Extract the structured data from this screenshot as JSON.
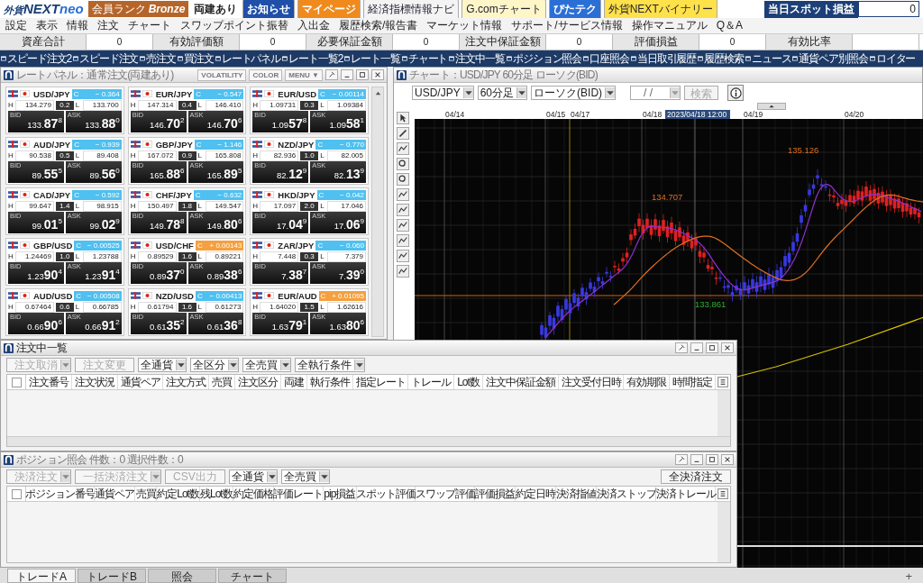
{
  "header": {
    "logo": {
      "prefix": "外貨",
      "main": "NEXT",
      "suffix": "neo"
    },
    "rank": {
      "caption": "会員ランク",
      "name": "Bronze"
    },
    "mode": "両建あり",
    "links": [
      {
        "label": "お知らせ",
        "color": "#1f4fa8"
      },
      {
        "label": "マイページ",
        "color": "#f08a1c"
      },
      {
        "label": "経済指標",
        "sub": "情報ナビ",
        "color": "#f4f4f4"
      },
      {
        "label": "G.com",
        "sub": "チャート",
        "color": "#fff6c8"
      },
      {
        "label": "ぴたテク",
        "color": "#2a6fd6"
      },
      {
        "label": "外貨NEXT",
        "sub": "バイナリー",
        "color": "#ffe14a"
      }
    ],
    "spot_pl": {
      "label": "当日スポット損益",
      "value": "0"
    }
  },
  "menu": [
    "設定",
    "表示",
    "情報",
    "注文",
    "チャート",
    "スワップポイント振替",
    "入出金",
    "履歴検索/報告書",
    "マーケット情報",
    "サポート/サービス情報",
    "操作マニュアル",
    "Q＆A"
  ],
  "summary": [
    {
      "label": "資産合計",
      "value": "0"
    },
    {
      "label": "有効評価額",
      "value": "0"
    },
    {
      "label": "必要保証金額",
      "value": "0"
    },
    {
      "label": "注文中保証金額",
      "value": "0"
    },
    {
      "label": "評価損益",
      "value": "0"
    },
    {
      "label": "有効比率"
    }
  ],
  "toolbar": [
    "スピード注文2",
    "スピード注文",
    "売注文",
    "買注文",
    "レートパネル",
    "レート一覧2",
    "レート一覧",
    "チャート",
    "注文中一覧",
    "ポジション照会",
    "口座照会",
    "当日取引履歴",
    "履歴検索",
    "ニュース",
    "通貨ペア別照会",
    "ロイター"
  ],
  "rate_panel": {
    "title": "レートパネル：通常注文(両建あり)",
    "buttons": [
      "VOLATILITY",
      "COLOR",
      "MENU ▼"
    ],
    "cards": [
      {
        "pair": "USD/JPY",
        "c": "C",
        "change": "− 0.364",
        "rising": false,
        "h": "H",
        "high": "134.279",
        "spread": "0.2",
        "l": "L",
        "low": "133.700",
        "bid": {
          "label": "BID",
          "pre": "133.",
          "big": "87",
          "sup": "8"
        },
        "ask": {
          "label": "ASK",
          "pre": "133.",
          "big": "88",
          "sup": "0"
        }
      },
      {
        "pair": "EUR/JPY",
        "c": "C",
        "change": "− 0.547",
        "rising": false,
        "h": "H",
        "high": "147.314",
        "spread": "0.4",
        "l": "L",
        "low": "146.410",
        "bid": {
          "label": "BID",
          "pre": "146.",
          "big": "70",
          "sup": "2"
        },
        "ask": {
          "label": "ASK",
          "pre": "146.",
          "big": "70",
          "sup": "6"
        }
      },
      {
        "pair": "EUR/USD",
        "c": "C",
        "change": "− 0.00114",
        "rising": false,
        "h": "H",
        "high": "1.09731",
        "spread": "0.3",
        "l": "L",
        "low": "1.09384",
        "bid": {
          "label": "BID",
          "pre": "1.09",
          "big": "57",
          "sup": "8"
        },
        "ask": {
          "label": "ASK",
          "pre": "1.09",
          "big": "58",
          "sup": "1"
        }
      },
      {
        "pair": "AUD/JPY",
        "c": "C",
        "change": "− 0.939",
        "rising": false,
        "h": "H",
        "high": "90.538",
        "spread": "0.5",
        "l": "L",
        "low": "89.408",
        "bid": {
          "label": "BID",
          "pre": "89.",
          "big": "55",
          "sup": "5"
        },
        "ask": {
          "label": "ASK",
          "pre": "89.",
          "big": "56",
          "sup": "0"
        }
      },
      {
        "pair": "GBP/JPY",
        "c": "C",
        "change": "− 1.146",
        "rising": false,
        "h": "H",
        "high": "167.072",
        "spread": "0.9",
        "l": "L",
        "low": "165.808",
        "bid": {
          "label": "BID",
          "pre": "165.",
          "big": "88",
          "sup": "6"
        },
        "ask": {
          "label": "ASK",
          "pre": "165.",
          "big": "89",
          "sup": "5"
        }
      },
      {
        "pair": "NZD/JPY",
        "c": "C",
        "change": "− 0.770",
        "rising": false,
        "h": "H",
        "high": "82.936",
        "spread": "1.0",
        "l": "L",
        "low": "82.005",
        "bid": {
          "label": "BID",
          "pre": "82.",
          "big": "12",
          "sup": "9"
        },
        "ask": {
          "label": "ASK",
          "pre": "82.",
          "big": "13",
          "sup": "9"
        }
      },
      {
        "pair": "CAD/JPY",
        "c": "C",
        "change": "− 0.592",
        "rising": false,
        "h": "H",
        "high": "99.647",
        "spread": "1.4",
        "l": "L",
        "low": "98.915",
        "bid": {
          "label": "BID",
          "pre": "99.",
          "big": "01",
          "sup": "5"
        },
        "ask": {
          "label": "ASK",
          "pre": "99.",
          "big": "02",
          "sup": "9"
        }
      },
      {
        "pair": "CHF/JPY",
        "c": "C",
        "change": "− 0.632",
        "rising": false,
        "h": "H",
        "high": "150.497",
        "spread": "1.8",
        "l": "L",
        "low": "149.547",
        "bid": {
          "label": "BID",
          "pre": "149.",
          "big": "78",
          "sup": "8"
        },
        "ask": {
          "label": "ASK",
          "pre": "149.",
          "big": "80",
          "sup": "6"
        }
      },
      {
        "pair": "HKD/JPY",
        "c": "C",
        "change": "− 0.042",
        "rising": false,
        "h": "H",
        "high": "17.097",
        "spread": "2.0",
        "l": "L",
        "low": "17.046",
        "bid": {
          "label": "BID",
          "pre": "17.",
          "big": "04",
          "sup": "9"
        },
        "ask": {
          "label": "ASK",
          "pre": "17.",
          "big": "06",
          "sup": "9"
        }
      },
      {
        "pair": "GBP/USD",
        "c": "C",
        "change": "− 0.00525",
        "rising": false,
        "h": "H",
        "high": "1.24469",
        "spread": "1.0",
        "l": "L",
        "low": "1.23788",
        "bid": {
          "label": "BID",
          "pre": "1.23",
          "big": "90",
          "sup": "4"
        },
        "ask": {
          "label": "ASK",
          "pre": "1.23",
          "big": "91",
          "sup": "4"
        }
      },
      {
        "pair": "USD/CHF",
        "c": "C",
        "change": "+ 0.00143",
        "rising": true,
        "h": "H",
        "high": "0.89529",
        "spread": "1.6",
        "l": "L",
        "low": "0.89221",
        "bid": {
          "label": "BID",
          "pre": "0.89",
          "big": "37",
          "sup": "0"
        },
        "ask": {
          "label": "ASK",
          "pre": "0.89",
          "big": "38",
          "sup": "6"
        }
      },
      {
        "pair": "ZAR/JPY",
        "c": "C",
        "change": "− 0.060",
        "rising": false,
        "h": "H",
        "high": "7.448",
        "spread": "0.3",
        "l": "L",
        "low": "7.379",
        "bid": {
          "label": "BID",
          "pre": "7.",
          "big": "38",
          "sup": "7"
        },
        "ask": {
          "label": "ASK",
          "pre": "7.",
          "big": "39",
          "sup": "0"
        }
      },
      {
        "pair": "AUD/USD",
        "c": "C",
        "change": "− 0.00508",
        "rising": false,
        "h": "H",
        "high": "0.67464",
        "spread": "0.6",
        "l": "L",
        "low": "0.66785",
        "bid": {
          "label": "BID",
          "pre": "0.66",
          "big": "90",
          "sup": "6"
        },
        "ask": {
          "label": "ASK",
          "pre": "0.66",
          "big": "91",
          "sup": "2"
        }
      },
      {
        "pair": "NZD/USD",
        "c": "C",
        "change": "− 0.00413",
        "rising": false,
        "h": "H",
        "high": "0.61794",
        "spread": "1.6",
        "l": "L",
        "low": "0.61273",
        "bid": {
          "label": "BID",
          "pre": "0.61",
          "big": "35",
          "sup": "2"
        },
        "ask": {
          "label": "ASK",
          "pre": "0.61",
          "big": "36",
          "sup": "8"
        }
      },
      {
        "pair": "EUR/AUD",
        "c": "C",
        "change": "+ 0.01095",
        "rising": true,
        "h": "H",
        "high": "1.64020",
        "spread": "1.5",
        "l": "L",
        "low": "1.62616",
        "bid": {
          "label": "BID",
          "pre": "1.63",
          "big": "79",
          "sup": "1"
        },
        "ask": {
          "label": "ASK",
          "pre": "1.63",
          "big": "80",
          "sup": "6"
        }
      }
    ]
  },
  "chart": {
    "title": "チャート：USD/JPY 60分足 ローソク(BID)",
    "selects": [
      "USD/JPY",
      "60分足",
      "ローソク(BID)"
    ],
    "date_field": "/ /",
    "search": {
      "label": "検索",
      "disabled": true
    },
    "dates": [
      "04/14",
      "04/15",
      "04/17",
      "04/18",
      "04/19",
      "04/20"
    ],
    "cursor_time": "2023/04/18 12:00",
    "price_labels": [
      {
        "text": "135.126",
        "kind": "high"
      },
      {
        "text": "134.707",
        "kind": "high"
      },
      {
        "text": "133.861",
        "kind": "low"
      }
    ]
  },
  "orders": {
    "title": "注文中一覧",
    "buttons": [
      {
        "label": "注文取消",
        "disabled": true,
        "dropdown": true
      },
      {
        "label": "注文変更",
        "disabled": true,
        "dropdown": false
      }
    ],
    "filters": [
      "全通貨",
      "全区分",
      "全売買",
      "全執行条件"
    ],
    "select_all": {
      "checked": false
    },
    "columns": [
      "注文番号",
      "注文状況",
      "通貨ペア",
      "注文方式",
      "売買",
      "注文区分",
      "両建",
      "執行条件",
      "指定レート",
      "トレール",
      "Lot数",
      "注文中保証金額",
      "注文受付日時",
      "有効期限",
      "時間指定"
    ]
  },
  "positions": {
    "title": "ポジション照会 件数：0 選択件数：0",
    "buttons": [
      {
        "label": "決済注文",
        "disabled": true,
        "dropdown": true
      },
      {
        "label": "一括決済注文",
        "disabled": true,
        "dropdown": true
      },
      {
        "label": "CSV出力",
        "disabled": true,
        "dropdown": false
      }
    ],
    "filters": [
      "全通貨",
      "全売買"
    ],
    "close_all": "全決済注文",
    "select_all": {
      "checked": false
    },
    "columns": [
      "ポジション番号",
      "通貨ペア",
      "売買",
      "約定Lot数",
      "残Lot数",
      "約定価格",
      "評価レート",
      "pip損益",
      "スポット評価",
      "スワップ評価",
      "評価損益",
      "約定日時",
      "決済指値",
      "決済ストップ",
      "決済トレール"
    ]
  },
  "tabs": [
    {
      "label": "トレードA",
      "selected": true
    },
    {
      "label": "トレードB",
      "selected": false
    },
    {
      "label": "照会",
      "selected": false
    },
    {
      "label": "チャート",
      "selected": false
    }
  ],
  "add_tab": "+"
}
